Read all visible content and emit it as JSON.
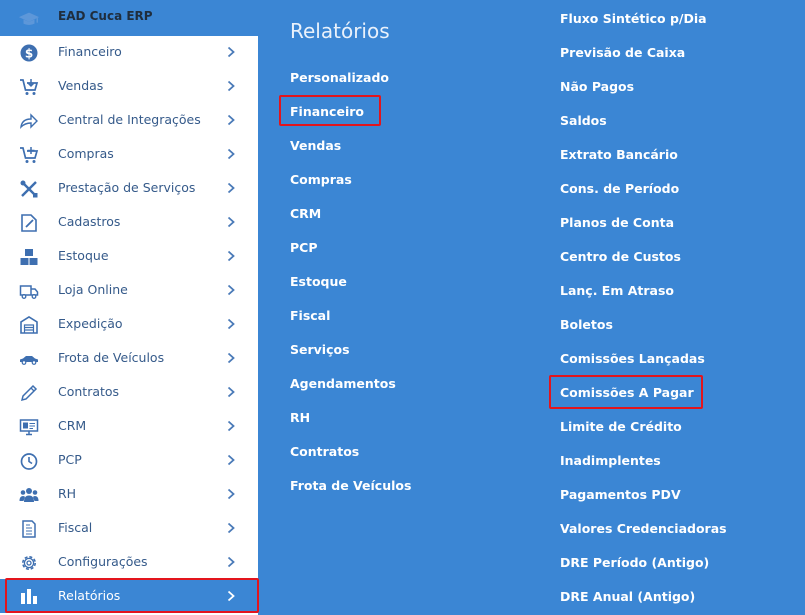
{
  "brand": {
    "name": "EAD Cuca ERP"
  },
  "sidebar": {
    "items": [
      {
        "label": "Financeiro",
        "icon": "dollar-circle-icon"
      },
      {
        "label": "Vendas",
        "icon": "cart-icon"
      },
      {
        "label": "Central de Integrações",
        "icon": "share-arrow-icon"
      },
      {
        "label": "Compras",
        "icon": "cart-plus-icon"
      },
      {
        "label": "Prestação de Serviços",
        "icon": "tools-icon"
      },
      {
        "label": "Cadastros",
        "icon": "edit-document-icon"
      },
      {
        "label": "Estoque",
        "icon": "boxes-icon"
      },
      {
        "label": "Loja Online",
        "icon": "truck-icon"
      },
      {
        "label": "Expedição",
        "icon": "warehouse-icon"
      },
      {
        "label": "Frota de Veículos",
        "icon": "car-icon"
      },
      {
        "label": "Contratos",
        "icon": "pen-icon"
      },
      {
        "label": "CRM",
        "icon": "monitor-icon"
      },
      {
        "label": "PCP",
        "icon": "clock-icon"
      },
      {
        "label": "RH",
        "icon": "people-icon"
      },
      {
        "label": "Fiscal",
        "icon": "receipt-icon"
      },
      {
        "label": "Configurações",
        "icon": "gear-icon"
      },
      {
        "label": "Relatórios",
        "icon": "bar-chart-icon"
      }
    ]
  },
  "submenu": {
    "title": "Relatórios",
    "items": [
      "Personalizado",
      "Financeiro",
      "Vendas",
      "Compras",
      "CRM",
      "PCP",
      "Estoque",
      "Fiscal",
      "Serviços",
      "Agendamentos",
      "RH",
      "Contratos",
      "Frota de Veículos"
    ]
  },
  "reports": {
    "items": [
      "Fluxo Sintético p/Dia",
      "Previsão de Caixa",
      "Não Pagos",
      "Saldos",
      "Extrato Bancário",
      "Cons. de Período",
      "Planos de Conta",
      "Centro de Custos",
      "Lanç. Em Atraso",
      "Boletos",
      "Comissões Lançadas",
      "Comissões A Pagar",
      "Limite de Crédito",
      "Inadimplentes",
      "Pagamentos PDV",
      "Valores Credenciadoras",
      "DRE Período (Antigo)",
      "DRE Anual (Antigo)"
    ]
  },
  "colors": {
    "accent": "#3b86d4",
    "highlight": "#e3151d",
    "sidebar_text": "#355a8a"
  }
}
